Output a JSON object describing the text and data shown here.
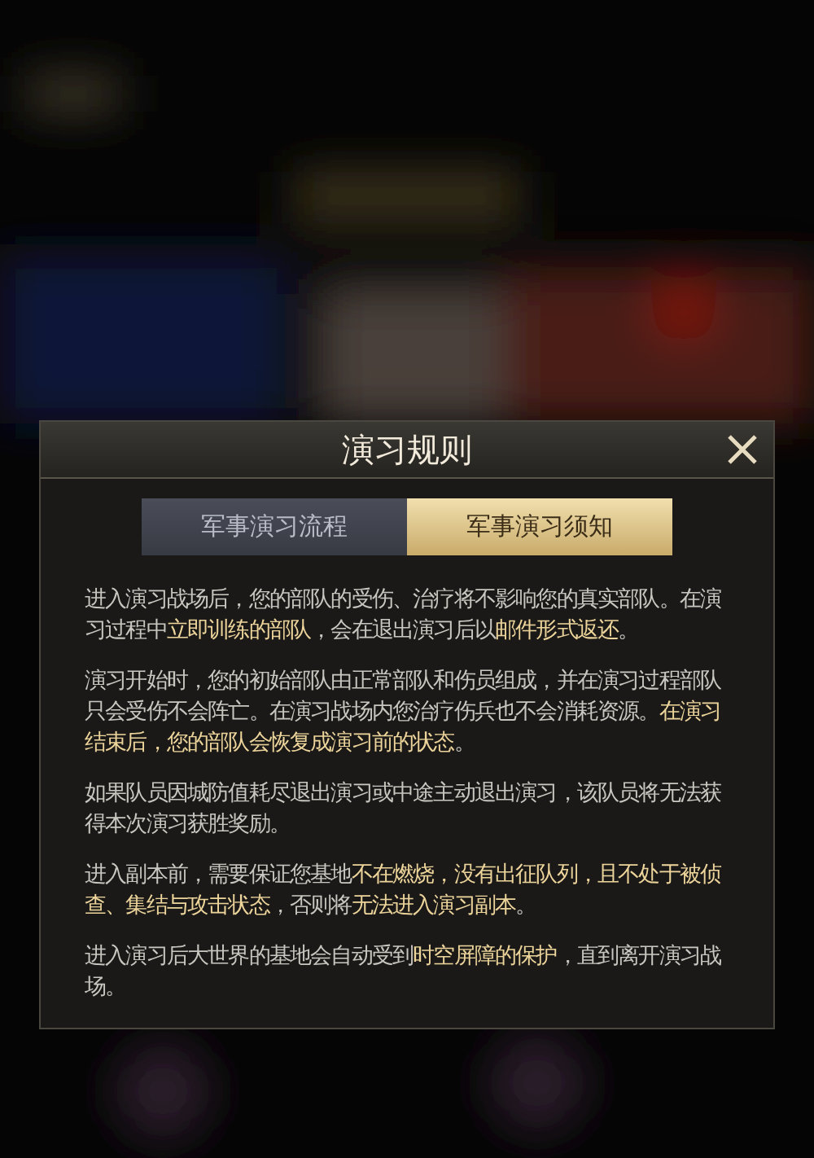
{
  "dialog": {
    "title": "演习规则",
    "tabs": [
      {
        "label": "军事演习流程",
        "selected": false
      },
      {
        "label": "军事演习须知",
        "selected": true
      }
    ],
    "paragraphs": [
      "进入演习战场后，您的部队的受伤、治疗将不影响您的真实部队。在演习过程中**立即训练的部队**，会在退出演习后以**邮件形式返还**。",
      "演习开始时，您的初始部队由正常部队和伤员组成，并在演习过程部队只会受伤不会阵亡。在演习战场内您治疗伤兵也不会消耗资源。**在演习结束后，您的部队会恢复成演习前的状态**。",
      "如果队员因城防值耗尽退出演习或中途主动退出演习，该队员将无法获得本次演习获胜奖励。",
      "进入副本前，需要保证您基地**不在燃烧，没有出征队列，且不处于被侦查、集结与攻击状态**，否则将**无法进入演习副本**。",
      "进入演习后大世界的基地会自动受到**时空屏障的保护**，直到离开演习战场。"
    ]
  }
}
